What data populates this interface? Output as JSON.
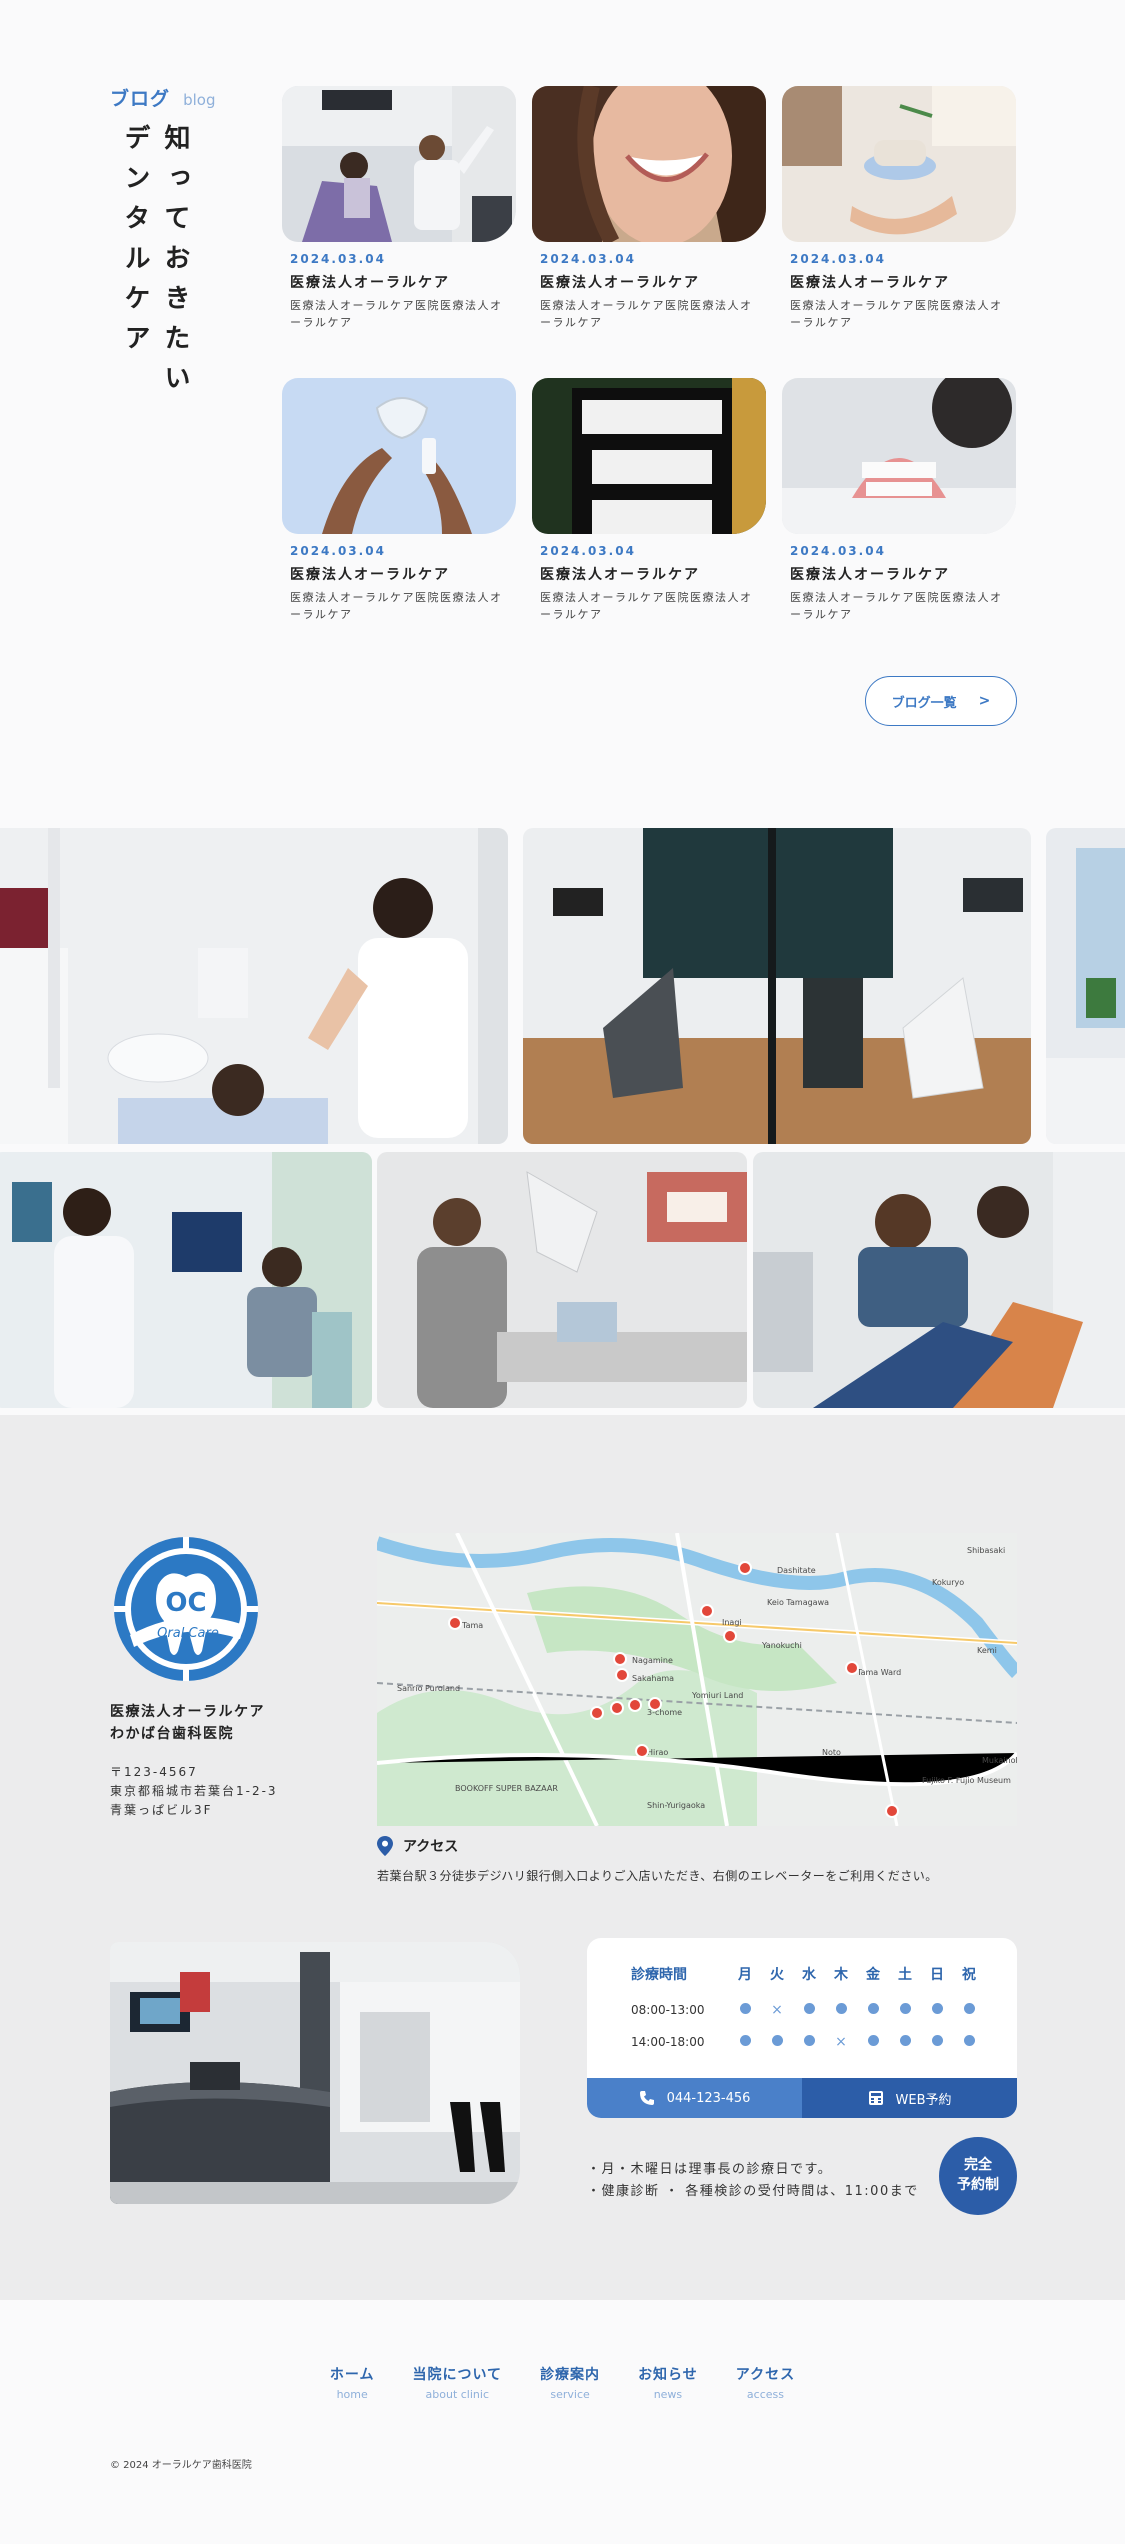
{
  "blog": {
    "heading_ja": "ブログ",
    "heading_en": "blog",
    "vertical_title_line1": "知っておきたい",
    "vertical_title_line2": "デンタルケア",
    "posts": [
      {
        "date": "2024.03.04",
        "title": "医療法人オーラルケア",
        "excerpt": "医療法人オーラルケア医院医療法人オーラルケア"
      },
      {
        "date": "2024.03.04",
        "title": "医療法人オーラルケア",
        "excerpt": "医療法人オーラルケア医院医療法人オーラルケア"
      },
      {
        "date": "2024.03.04",
        "title": "医療法人オーラルケア",
        "excerpt": "医療法人オーラルケア医院医療法人オーラルケア"
      },
      {
        "date": "2024.03.04",
        "title": "医療法人オーラルケア",
        "excerpt": "医療法人オーラルケア医院医療法人オーラルケア"
      },
      {
        "date": "2024.03.04",
        "title": "医療法人オーラルケア",
        "excerpt": "医療法人オーラルケア医院医療法人オーラルケア"
      },
      {
        "date": "2024.03.04",
        "title": "医療法人オーラルケア",
        "excerpt": "医療法人オーラルケア医院医療法人オーラルケア"
      }
    ],
    "more_label": "ブログ一覧",
    "more_arrow": ">"
  },
  "map": {
    "labels": [
      "Dashitate",
      "Keio Tamagawa",
      "Kokuryo",
      "Shibasaki",
      "Inagi",
      "Yanokuchi",
      "Nagamine",
      "Sakahama",
      "Tama Ward",
      "Yomiuri Land",
      "3-chome",
      "Hirao",
      "Noto",
      "Tama",
      "BOOKOFF SUPER BAZAAR",
      "Sanrio Puroland",
      "Fujiko F. Fujio Museum",
      "Mukainoka",
      "Shin-Yurigaoka",
      "Kemi"
    ]
  },
  "clinic": {
    "logo_letters": "OC",
    "logo_text": "Oral Care",
    "name_line1": "医療法人オーラルケア",
    "name_line2": "わかば台歯科医院",
    "postal": "〒123-4567",
    "address_line1": "東京都稲城市若葉台1-2-3",
    "address_line2": "青葉っぱビル3F",
    "access_label": "アクセス",
    "access_text": "若葉台駅３分徒歩デジハリ銀行側入口よりご入店いただき、右側のエレベーターをご利用ください。"
  },
  "hours": {
    "header_label": "診療時間",
    "days": [
      "月",
      "火",
      "水",
      "木",
      "金",
      "土",
      "日",
      "祝"
    ],
    "rows": [
      {
        "time": "08:00-13:00",
        "marks": [
          "dot",
          "cross",
          "dot",
          "dot",
          "dot",
          "dot",
          "dot",
          "dot"
        ]
      },
      {
        "time": "14:00-18:00",
        "marks": [
          "dot",
          "dot",
          "dot",
          "cross",
          "dot",
          "dot",
          "dot",
          "dot"
        ]
      }
    ],
    "tel_label": "044-123-456",
    "web_label": "WEB予約"
  },
  "notes": {
    "line1": "・月・木曜日は理事長の診療日です。",
    "line2": "・健康診断 ・ 各種検診の受付時間は、11:00まで"
  },
  "badge": {
    "line1": "完全",
    "line2": "予約制"
  },
  "footer": {
    "nav": [
      {
        "ja": "ホーム",
        "en": "home"
      },
      {
        "ja": "当院について",
        "en": "about clinic"
      },
      {
        "ja": "診療案内",
        "en": "service"
      },
      {
        "ja": "お知らせ",
        "en": "news"
      },
      {
        "ja": "アクセス",
        "en": "access"
      }
    ],
    "copyright": "© 2024 オーラルケア歯科医院"
  },
  "colors": {
    "accent": "#3d79c4",
    "accent_dark": "#2c5da8",
    "info_bg": "#ececed"
  }
}
